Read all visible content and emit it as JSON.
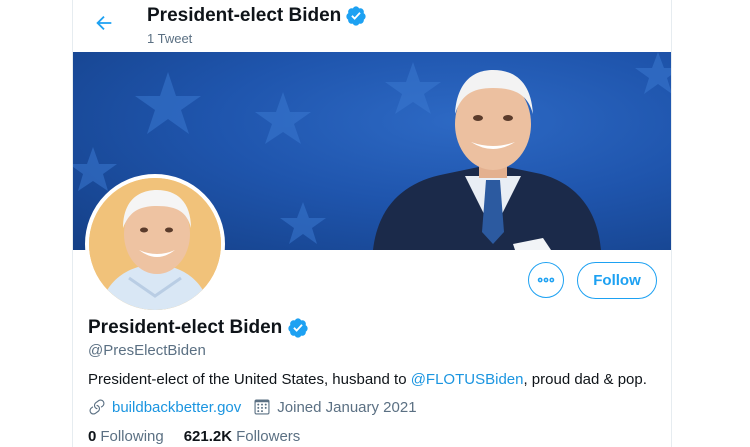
{
  "header": {
    "back_icon": "arrow-left-icon",
    "name": "President-elect Biden",
    "tweet_count": "1 Tweet",
    "verified_icon": "verified-badge-icon"
  },
  "profile": {
    "name": "President-elect Biden",
    "handle": "@PresElectBiden",
    "bio_prefix": "President-elect of the United States, husband to ",
    "bio_mention": "@FLOTUSBiden",
    "bio_suffix": ", proud dad & pop.",
    "website": "buildbackbetter.gov",
    "joined": "Joined January 2021",
    "following_count": "0",
    "following_label": "Following",
    "followers_count": "621.2K",
    "followers_label": "Followers"
  },
  "actions": {
    "more_icon": "more-dots-icon",
    "follow_label": "Follow"
  },
  "colors": {
    "accent": "#1da1f2",
    "link": "#1b95e0",
    "secondary_text": "#5b7083",
    "banner_blue": "#1f55ad"
  }
}
